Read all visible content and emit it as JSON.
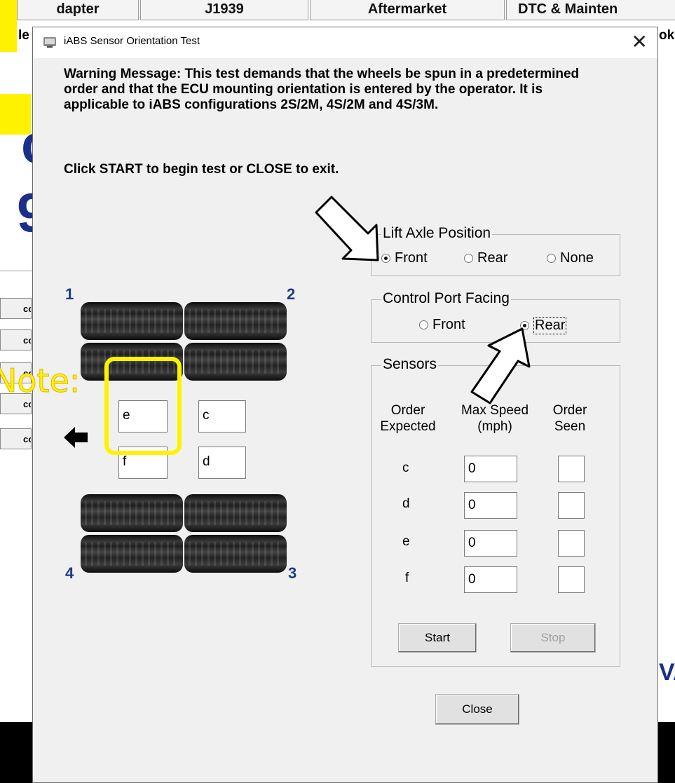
{
  "background": {
    "tabs": [
      "dapter",
      "J1939",
      "Aftermarket",
      "DTC & Mainten"
    ],
    "behind_title_left": "le",
    "behind_title_right": "ok",
    "side_buttons": [
      "co",
      "co",
      "co",
      "co",
      "co"
    ],
    "big_letters": [
      "c",
      "9"
    ],
    "brand_fragment": "VA"
  },
  "dialog": {
    "title": "iABS Sensor Orientation Test",
    "close_glyph": "✕",
    "warning": "Warning Message: This test demands that the wheels be spun in a predetermined order and that the ECU mounting orientation is entered by the operator.  It is applicable to iABS configurations 2S/2M, 4S/2M and 4S/3M.",
    "instruction": "Click START to begin test or CLOSE to exit.",
    "lift_axle": {
      "legend": "Lift Axle Position",
      "options": [
        "Front",
        "Rear",
        "None"
      ],
      "selected": "Front"
    },
    "control_port": {
      "legend": "Control Port Facing",
      "options": [
        "Front",
        "Rear"
      ],
      "selected": "Rear"
    },
    "sensors": {
      "legend": "Sensors",
      "col_order_expected": [
        "Order",
        "Expected"
      ],
      "col_max_speed": [
        "Max Speed",
        "(mph)"
      ],
      "col_order_seen": [
        "Order",
        "Seen"
      ],
      "rows": [
        {
          "letter": "c",
          "speed": "0",
          "seen": ""
        },
        {
          "letter": "d",
          "speed": "0",
          "seen": ""
        },
        {
          "letter": "e",
          "speed": "0",
          "seen": ""
        },
        {
          "letter": "f",
          "speed": "0",
          "seen": ""
        }
      ],
      "start_label": "Start",
      "stop_label": "Stop"
    },
    "close_label": "Close",
    "diagram": {
      "corner_numbers": [
        "1",
        "2",
        "3",
        "4"
      ],
      "boxes": {
        "left_top": "e",
        "right_top": "c",
        "left_bottom": "f",
        "right_bottom": "d"
      },
      "note": "Note:"
    }
  },
  "colors": {
    "highlight": "#fff200",
    "corner_number": "#1e3a8a",
    "dialog_bg": "#f0f0f0"
  }
}
